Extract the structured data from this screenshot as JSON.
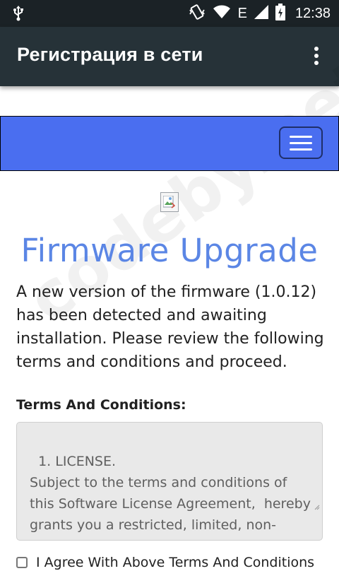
{
  "status_bar": {
    "time": "12:38",
    "network_type": "E",
    "icons": [
      "usb-icon",
      "vibrate-icon",
      "wifi-icon",
      "cell-signal-icon",
      "battery-charging-icon"
    ]
  },
  "app_bar": {
    "title": "Регистрация в сети",
    "menu_icon": "overflow-menu-icon"
  },
  "web": {
    "navbar": {
      "background": "#4a6ef0",
      "toggler_icon": "hamburger-menu-icon"
    },
    "heading": "Firmware Upgrade",
    "intro": "A new version of the firmware (1.0.12) has been detected and awaiting installation. Please review the following terms and conditions and proceed.",
    "terms_label": "Terms And Conditions:",
    "terms_text": "1. LICENSE.\nSubject to the terms and conditions of this Software License Agreement,  hereby grants you a restricted, limited, non-exclusive, non-transferable, license to use the Firmware/Software/Drivers and…",
    "agree_label": "I Agree With Above Terms And Conditions"
  },
  "watermark": "codeby.net",
  "colors": {
    "status_bar": "#1b2226",
    "app_bar": "#263238",
    "heading": "#5b86e5"
  }
}
